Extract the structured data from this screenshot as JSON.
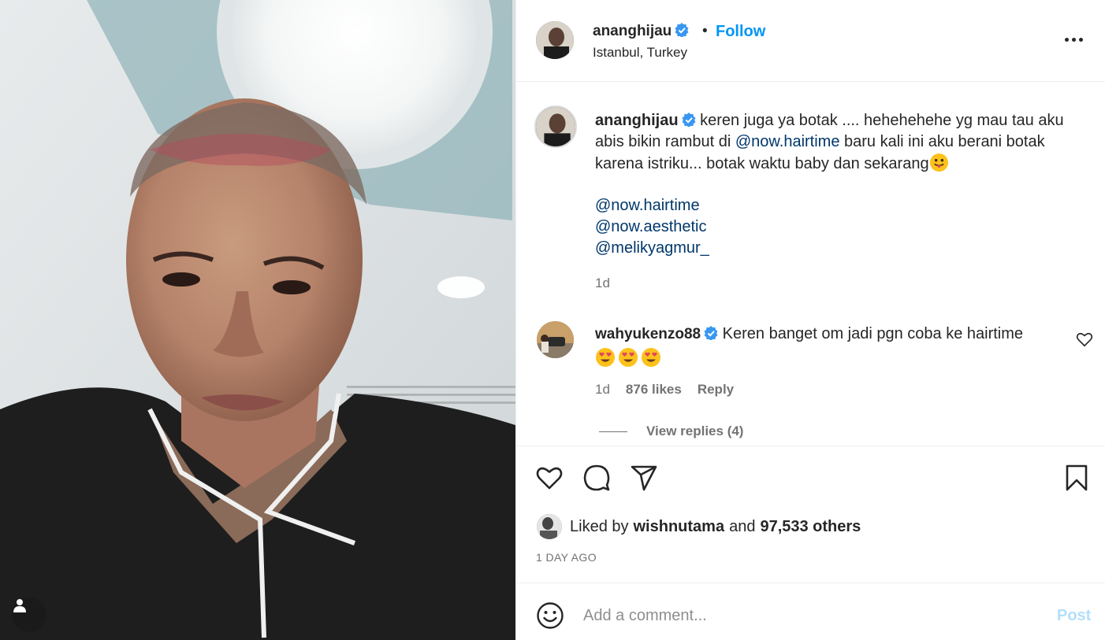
{
  "post": {
    "username": "ananghijau",
    "follow_label": "Follow",
    "separator": "•",
    "location": "Istanbul, Turkey",
    "caption_text_1": "keren juga ya botak .... hehehehehe yg mau tau aku abis bikin rambut di ",
    "caption_mention": "@now.hairtime",
    "caption_text_2": " baru kali ini aku berani botak karena istriku... botak waktu baby dan sekarang",
    "mentions": [
      "@now.hairtime",
      "@now.aesthetic",
      "@melikyagmur_"
    ],
    "caption_time": "1d"
  },
  "comment": {
    "username": "wahyukenzo88",
    "text": "Keren banget om jadi pgn coba ke hairtime",
    "time": "1d",
    "likes": "876 likes",
    "reply_label": "Reply",
    "view_replies": "View replies (4)"
  },
  "engagement": {
    "liked_by_prefix": "Liked by",
    "liked_by_user": "wishnutama",
    "and_label": "and",
    "others": "97,533 others",
    "timestamp": "1 DAY AGO"
  },
  "composer": {
    "placeholder": "Add a comment...",
    "post_label": "Post"
  },
  "icons": {
    "verified": "verified-badge-icon",
    "more": "more-options-icon",
    "like": "heart-icon",
    "comment": "comment-bubble-icon",
    "share": "paper-plane-icon",
    "save": "bookmark-icon",
    "emoji": "smiley-icon",
    "tag": "user-tag-icon"
  },
  "colors": {
    "accent": "#0095f6",
    "mention": "#00376b",
    "muted": "#737373",
    "post_disabled": "#b2dffc",
    "verified": "#3897f0"
  }
}
